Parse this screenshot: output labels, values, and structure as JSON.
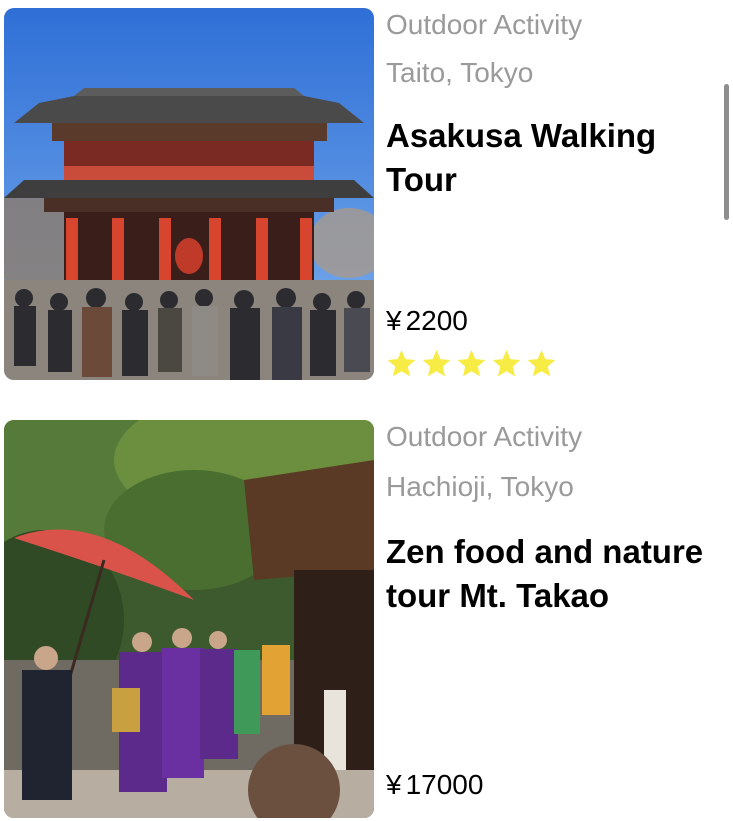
{
  "listings": [
    {
      "category": "Outdoor Activity",
      "location": "Taito, Tokyo",
      "title": "Asakusa Walking Tour",
      "currency": "¥",
      "price": "2200",
      "rating": 5,
      "star_color": "#f7ec45",
      "image_icon": "temple-gate-photo"
    },
    {
      "category": "Outdoor Activity",
      "location": "Hachioji, Tokyo",
      "title": "Zen food and nature tour Mt. Takao",
      "currency": "¥",
      "price": "17000",
      "image_icon": "monks-procession-photo"
    }
  ],
  "colors": {
    "secondary_text": "#9a9a9a",
    "primary_text": "#000000",
    "star": "#f7ec45",
    "scrollbar": "#8e8e8e"
  }
}
